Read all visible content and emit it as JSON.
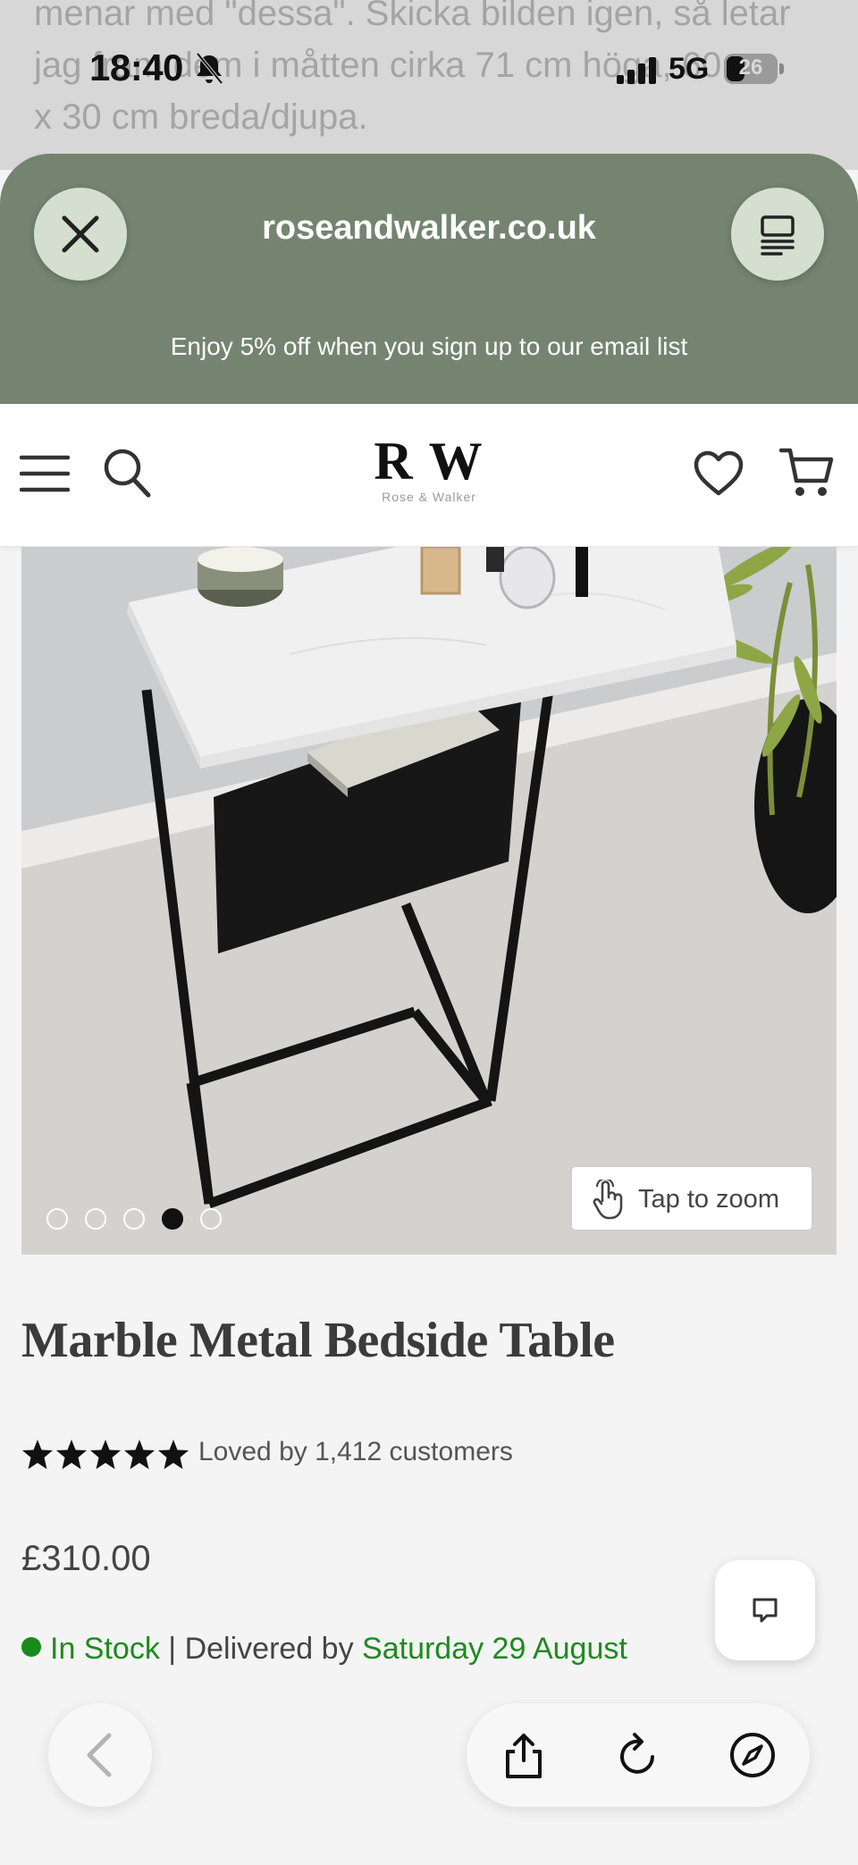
{
  "background_article": {
    "line1": "menar med \"dessa\". Skicka bilden igen, så letar",
    "line2": "jag fram dem i måtten cirka 71 cm höga, 60",
    "line3": "x 30 cm breda/djupa."
  },
  "status_bar": {
    "time": "18:40",
    "network": "5G",
    "battery": "26"
  },
  "browser": {
    "domain": "roseandwalker.co.uk",
    "close_icon": "close-icon",
    "reader_icon": "reader-mode-icon"
  },
  "promo": {
    "text": "Enjoy 5% off when you sign up to our email list"
  },
  "site_nav": {
    "logo_mark": "R W",
    "logo_subtitle": "Rose & Walker"
  },
  "product": {
    "image_dots": [
      {
        "active": false
      },
      {
        "active": false
      },
      {
        "active": false
      },
      {
        "active": true
      },
      {
        "active": false
      }
    ],
    "zoom_label": "Tap to zoom",
    "title": "Marble Metal Bedside Table",
    "rating_stars": 5,
    "rating_text": "Loved by 1,412 customers",
    "price": "£310.00",
    "stock_status": "In Stock",
    "separator": "|",
    "delivery_prefix": "Delivered by",
    "delivery_date": "Saturday 29 August"
  },
  "colors": {
    "sheet_header": "#748470",
    "button_bg": "#d4dfcf",
    "stock_green": "#1f8a1f"
  }
}
